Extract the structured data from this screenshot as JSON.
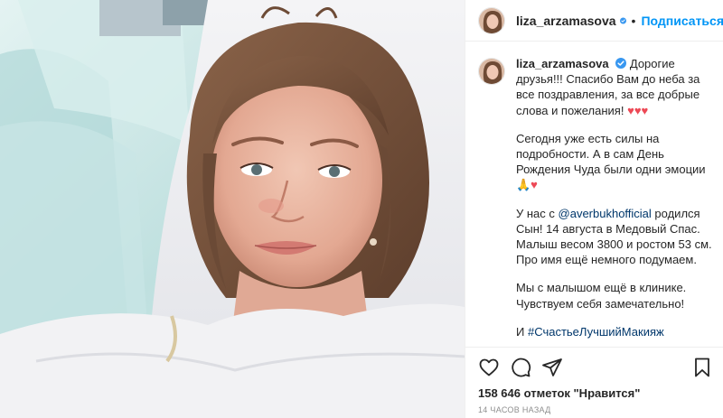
{
  "post": {
    "username": "liza_arzamasova",
    "follow_label": "Подписаться",
    "separator": "•",
    "caption": {
      "line1": "Дорогие друзья!!! Спасибо Вам до неба за все поздравления, за все добрые слова и пожелания!",
      "hearts1": "♥♥♥",
      "para2": "Сегодня уже есть силы на подробности. А в сам День Рождения Чуда были одни эмоции",
      "emoji2": "🙏♥",
      "para3_pre": "У нас с ",
      "mention": "@averbukhofficial",
      "para3_post": " родился Сын! 14 августа в Медовый Спас. Малыш весом 3800 и ростом 53 см. Про имя ещё немного подумаем.",
      "para4": "Мы с малышом ещё в клинике. Чувствуем себя замечательно!",
      "para5_pre": "И ",
      "hashtag": "#СчастьеЛучшийМакияж"
    },
    "likes_text": "158 646 отметок \"Нравится\"",
    "time_text": "14 ЧАСОВ НАЗАД"
  },
  "colors": {
    "link": "#00376b",
    "follow": "#0095f6",
    "heart": "#ed4956",
    "verified": "#3897f0"
  },
  "icons": [
    "like-icon",
    "comment-icon",
    "share-icon",
    "bookmark-icon",
    "verified-icon"
  ]
}
